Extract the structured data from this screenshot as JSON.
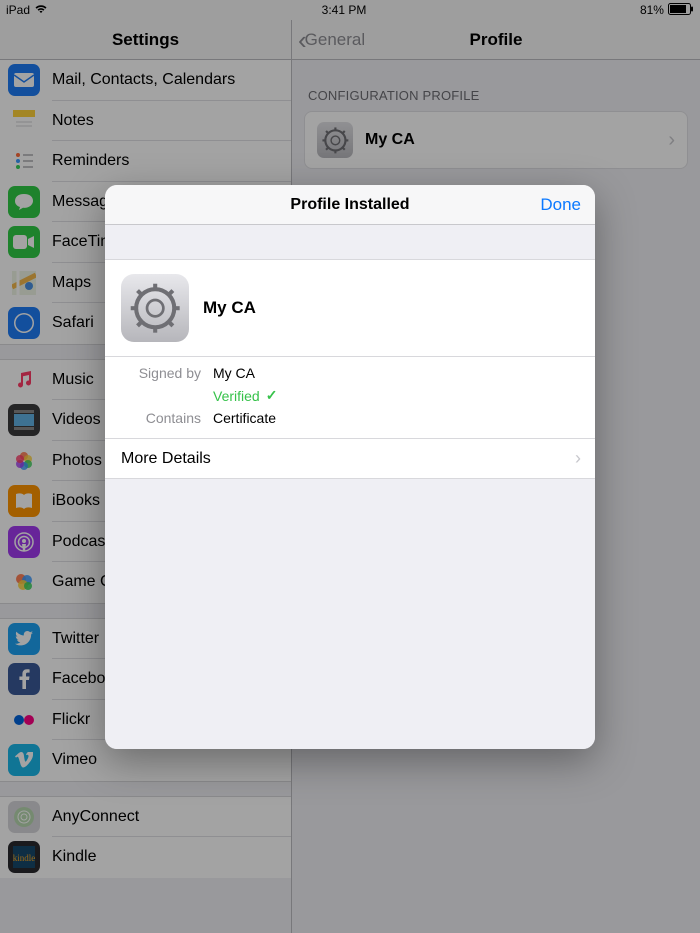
{
  "status": {
    "device": "iPad",
    "time": "3:41 PM",
    "battery_text": "81%"
  },
  "sidebar": {
    "title": "Settings",
    "groups": [
      {
        "items": [
          {
            "label": "Mail, Contacts, Calendars",
            "icon": "mail",
            "bg": "#1f7cf6"
          },
          {
            "label": "Notes",
            "icon": "notes",
            "bg": "#fff"
          },
          {
            "label": "Reminders",
            "icon": "reminders",
            "bg": "#fff"
          },
          {
            "label": "Messages",
            "icon": "messages",
            "bg": "#2fcc46"
          },
          {
            "label": "FaceTime",
            "icon": "facetime",
            "bg": "#2fcc46"
          },
          {
            "label": "Maps",
            "icon": "maps",
            "bg": "#fff"
          },
          {
            "label": "Safari",
            "icon": "safari",
            "bg": "#1f7cf6"
          }
        ]
      },
      {
        "items": [
          {
            "label": "Music",
            "icon": "music",
            "bg": "#fff"
          },
          {
            "label": "Videos",
            "icon": "videos",
            "bg": "#3a3a3c"
          },
          {
            "label": "Photos & Camera",
            "icon": "photos",
            "bg": "#fff"
          },
          {
            "label": "iBooks",
            "icon": "ibooks",
            "bg": "#ff9500"
          },
          {
            "label": "Podcasts",
            "icon": "podcasts",
            "bg": "#a23bf0"
          },
          {
            "label": "Game Center",
            "icon": "gamecenter",
            "bg": "#fff"
          }
        ]
      },
      {
        "items": [
          {
            "label": "Twitter",
            "icon": "twitter",
            "bg": "#1da1f2"
          },
          {
            "label": "Facebook",
            "icon": "facebook",
            "bg": "#3b5998"
          },
          {
            "label": "Flickr",
            "icon": "flickr",
            "bg": "#fff"
          },
          {
            "label": "Vimeo",
            "icon": "vimeo",
            "bg": "#1ab7ea"
          }
        ]
      },
      {
        "items": [
          {
            "label": "AnyConnect",
            "icon": "anyconnect",
            "bg": "#d7d7db"
          },
          {
            "label": "Kindle",
            "icon": "kindle",
            "bg": "#2a2a2e"
          }
        ]
      }
    ]
  },
  "detail": {
    "back_label": "General",
    "title": "Profile",
    "section_label": "CONFIGURATION PROFILE",
    "profile_name": "My CA"
  },
  "modal": {
    "title": "Profile Installed",
    "done_label": "Done",
    "profile_name": "My CA",
    "signed_by_label": "Signed by",
    "signed_by_value": "My CA",
    "verified_label": "Verified",
    "contains_label": "Contains",
    "contains_value": "Certificate",
    "more_details_label": "More Details"
  }
}
